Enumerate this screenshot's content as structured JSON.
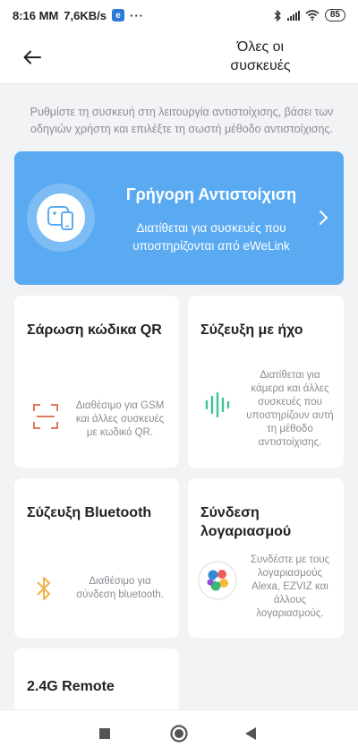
{
  "status_bar": {
    "time": "8:16 MM",
    "net_speed": "7,6KB/s",
    "app_badge": "e",
    "more": "···",
    "battery": "85",
    "icons": [
      "bluetooth-icon",
      "signal-icon",
      "wifi-icon",
      "battery-icon"
    ]
  },
  "header": {
    "title": "Όλες οι συσκευές",
    "back_icon": "arrow-left-icon"
  },
  "intro_text": "Ρυθμίστε τη συσκευή στη λειτουργία αντιστοίχισης, βάσει των οδηγιών χρήστη και επιλέξτε τη σωστή μέθοδο αντιστοίχισης.",
  "quick_pairing": {
    "title": "Γρήγορη Αντιστοίχιση",
    "description": "Διατίθεται για συσκευές που υποστηρίζονται από eWeLink",
    "icon": "devices-icon",
    "accent": "#5aaaf2"
  },
  "modes": [
    {
      "title": "Σάρωση κώδικα QR",
      "description": "Διαθέσιμο για GSM και άλλες συσκευές με κωδικό QR.",
      "icon": "qr-scan-icon",
      "color": "#e07a5f"
    },
    {
      "title": "Σύζευξη με ήχο",
      "description": "Διατίθεται για κάμερα και άλλες συσκευές που υποστηρίζουν αυτή τη μέθοδο αντιστοίχισης.",
      "icon": "sound-wave-icon",
      "color": "#3cc39a"
    },
    {
      "title": "Σύζευξη Bluetooth",
      "description": "Διαθέσιμο για σύνδεση bluetooth.",
      "icon": "bluetooth-icon",
      "color": "#f0b54a"
    },
    {
      "title": "Σύνδεση λογαριασμού",
      "description": "Συνδέστε με τους λογαριασμούς Alexa, EZVIZ και άλλους λογαριασμούς.",
      "icon": "accounts-icon",
      "color": "#444444"
    },
    {
      "title": "2.4G Remote",
      "description": "",
      "icon": "",
      "color": ""
    }
  ],
  "nav": {
    "icons": [
      "recent-apps-icon",
      "home-icon",
      "back-icon"
    ]
  }
}
